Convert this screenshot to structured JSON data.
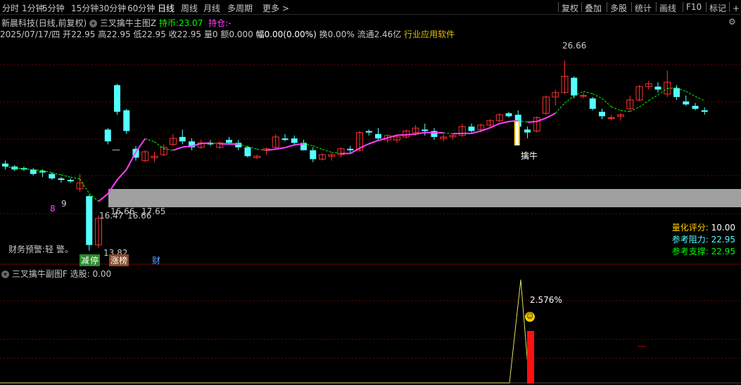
{
  "toolbar": {
    "periods": [
      "分时",
      "1分钟",
      "5分钟",
      "15分钟",
      "30分钟",
      "60分钟",
      "日线",
      "周线",
      "月线",
      "多周期",
      "更多 >"
    ],
    "active_period": "日线",
    "right_buttons": [
      "复权",
      "叠加",
      "多股",
      "统计",
      "画线",
      "F10",
      "标记",
      "+自"
    ]
  },
  "header": {
    "stock_name": "新晨科技",
    "period_info": "(日线,前复权)",
    "indicator": "三叉擒牛主图Z",
    "hold_label": "持币:",
    "hold_value": "23.07",
    "position_label": "持仓:",
    "position_value": "-"
  },
  "quote": {
    "date": "2025/07/17/四",
    "open_label": "开",
    "open": "22.95",
    "high_label": "高",
    "high": "22.95",
    "low_label": "低",
    "low": "22.95",
    "close_label": "收",
    "close": "22.95",
    "volume_label": "量",
    "volume": "0",
    "amount_label": "额",
    "amount": "0.000",
    "change_label": "幅",
    "change": "0.00(0.00%)",
    "turnover_label": "换",
    "turnover": "0.00%",
    "float_label": "流通",
    "float": "2.46亿",
    "industry": "行业应用软件"
  },
  "annotations": {
    "max_price": "26.66",
    "low1": "16.47",
    "low2": "16.66",
    "low3": "16.66",
    "low4": "17.65",
    "min_price": "13.82",
    "count8": "8",
    "count9": "9",
    "dash": "—",
    "signal": "擒牛",
    "warning": "财务预警:轻 警。",
    "tag_reduce": "减",
    "tag_stop": "停",
    "tag_limit": "涨榜",
    "tag_fin": "财"
  },
  "stats": {
    "score_label": "量化评分:",
    "score": "10.00",
    "resist_label": "参考阻力:",
    "resist": "22.95",
    "support_label": "参考支撑:",
    "support": "22.95"
  },
  "sub": {
    "indicator": "三叉擒牛副图F",
    "select_label": "选股:",
    "select_value": "0.00",
    "pct": "2.576%"
  },
  "colors": {
    "up": "#ff3030",
    "down": "#54ffff",
    "line_up": "#ff40ff",
    "line_dn": "#00ff00",
    "grid": "#7a0000",
    "band": "#a0a0a0"
  },
  "chart_data": {
    "type": "candlestick",
    "y_range": [
      13.0,
      28.0
    ],
    "candles": [
      {
        "o": 19.7,
        "h": 19.9,
        "l": 19.3,
        "c": 19.5
      },
      {
        "o": 19.5,
        "h": 19.6,
        "l": 19.2,
        "c": 19.3
      },
      {
        "o": 19.4,
        "h": 19.5,
        "l": 19.2,
        "c": 19.3
      },
      {
        "o": 19.3,
        "h": 19.4,
        "l": 18.9,
        "c": 19.0
      },
      {
        "o": 19.2,
        "h": 19.3,
        "l": 18.8,
        "c": 19.1
      },
      {
        "o": 19.0,
        "h": 19.1,
        "l": 18.6,
        "c": 18.7
      },
      {
        "o": 18.7,
        "h": 18.8,
        "l": 18.4,
        "c": 18.6
      },
      {
        "o": 18.6,
        "h": 18.7,
        "l": 18.4,
        "c": 18.5
      },
      {
        "o": 18.0,
        "h": 19.0,
        "l": 17.8,
        "c": 18.4
      },
      {
        "o": 17.5,
        "h": 17.6,
        "l": 13.82,
        "c": 14.2
      },
      {
        "o": 14.2,
        "h": 16.2,
        "l": 14.0,
        "c": 16.0
      },
      {
        "o": 22.0,
        "h": 22.1,
        "l": 21.0,
        "c": 21.2
      },
      {
        "o": 25.0,
        "h": 25.1,
        "l": 23.0,
        "c": 23.2
      },
      {
        "o": 23.3,
        "h": 23.4,
        "l": 21.7,
        "c": 21.9
      },
      {
        "o": 20.7,
        "h": 20.9,
        "l": 19.9,
        "c": 20.1
      },
      {
        "o": 19.9,
        "h": 20.6,
        "l": 19.8,
        "c": 20.5
      },
      {
        "o": 20.1,
        "h": 20.5,
        "l": 19.8,
        "c": 20.2
      },
      {
        "o": 20.3,
        "h": 21.0,
        "l": 20.2,
        "c": 20.8
      },
      {
        "o": 21.0,
        "h": 21.7,
        "l": 20.9,
        "c": 21.4
      },
      {
        "o": 21.5,
        "h": 22.0,
        "l": 21.0,
        "c": 21.2
      },
      {
        "o": 21.2,
        "h": 21.4,
        "l": 20.6,
        "c": 20.8
      },
      {
        "o": 20.8,
        "h": 21.3,
        "l": 20.7,
        "c": 21.1
      },
      {
        "o": 21.1,
        "h": 21.3,
        "l": 20.9,
        "c": 21.0
      },
      {
        "o": 20.8,
        "h": 21.2,
        "l": 20.7,
        "c": 21.1
      },
      {
        "o": 21.3,
        "h": 21.5,
        "l": 21.0,
        "c": 21.1
      },
      {
        "o": 21.1,
        "h": 21.3,
        "l": 20.6,
        "c": 20.8
      },
      {
        "o": 20.8,
        "h": 20.9,
        "l": 20.1,
        "c": 20.2
      },
      {
        "o": 20.1,
        "h": 20.3,
        "l": 20.0,
        "c": 20.2
      },
      {
        "o": 20.6,
        "h": 20.8,
        "l": 20.3,
        "c": 20.7
      },
      {
        "o": 20.8,
        "h": 21.7,
        "l": 20.7,
        "c": 21.5
      },
      {
        "o": 21.4,
        "h": 21.7,
        "l": 21.2,
        "c": 21.3
      },
      {
        "o": 21.4,
        "h": 21.6,
        "l": 21.0,
        "c": 21.1
      },
      {
        "o": 21.1,
        "h": 21.3,
        "l": 20.6,
        "c": 20.6
      },
      {
        "o": 20.6,
        "h": 20.8,
        "l": 19.8,
        "c": 20.0
      },
      {
        "o": 20.0,
        "h": 20.4,
        "l": 19.9,
        "c": 20.3
      },
      {
        "o": 20.2,
        "h": 20.4,
        "l": 19.9,
        "c": 20.3
      },
      {
        "o": 20.3,
        "h": 20.8,
        "l": 20.1,
        "c": 20.7
      },
      {
        "o": 20.7,
        "h": 20.9,
        "l": 20.4,
        "c": 20.6
      },
      {
        "o": 20.6,
        "h": 21.9,
        "l": 20.5,
        "c": 21.8
      },
      {
        "o": 21.9,
        "h": 22.0,
        "l": 21.6,
        "c": 21.8
      },
      {
        "o": 21.7,
        "h": 22.1,
        "l": 21.3,
        "c": 21.4
      },
      {
        "o": 21.3,
        "h": 21.7,
        "l": 21.1,
        "c": 21.6
      },
      {
        "o": 21.3,
        "h": 21.6,
        "l": 21.1,
        "c": 21.5
      },
      {
        "o": 21.5,
        "h": 22.0,
        "l": 21.4,
        "c": 21.9
      },
      {
        "o": 21.8,
        "h": 22.3,
        "l": 21.6,
        "c": 22.1
      },
      {
        "o": 22.0,
        "h": 22.4,
        "l": 21.6,
        "c": 21.9
      },
      {
        "o": 21.9,
        "h": 22.1,
        "l": 21.3,
        "c": 21.5
      },
      {
        "o": 21.4,
        "h": 21.7,
        "l": 21.2,
        "c": 21.5
      },
      {
        "o": 21.5,
        "h": 21.7,
        "l": 21.3,
        "c": 21.6
      },
      {
        "o": 21.6,
        "h": 22.4,
        "l": 21.5,
        "c": 22.2
      },
      {
        "o": 22.2,
        "h": 22.4,
        "l": 21.8,
        "c": 21.9
      },
      {
        "o": 22.0,
        "h": 22.4,
        "l": 21.8,
        "c": 22.3
      },
      {
        "o": 22.3,
        "h": 22.7,
        "l": 22.1,
        "c": 22.6
      },
      {
        "o": 22.6,
        "h": 23.1,
        "l": 22.5,
        "c": 23.0
      },
      {
        "o": 23.1,
        "h": 23.2,
        "l": 22.8,
        "c": 22.9
      },
      {
        "o": 23.0,
        "h": 23.3,
        "l": 21.9,
        "c": 22.2
      },
      {
        "o": 22.0,
        "h": 22.2,
        "l": 21.4,
        "c": 21.8
      },
      {
        "o": 21.9,
        "h": 22.9,
        "l": 21.8,
        "c": 22.8
      },
      {
        "o": 23.1,
        "h": 24.3,
        "l": 23.0,
        "c": 24.2
      },
      {
        "o": 24.2,
        "h": 24.7,
        "l": 23.6,
        "c": 24.5
      },
      {
        "o": 24.5,
        "h": 26.66,
        "l": 24.4,
        "c": 25.6
      },
      {
        "o": 25.5,
        "h": 25.6,
        "l": 24.1,
        "c": 24.3
      },
      {
        "o": 24.3,
        "h": 24.5,
        "l": 24.1,
        "c": 24.3
      },
      {
        "o": 24.1,
        "h": 24.2,
        "l": 23.3,
        "c": 23.4
      },
      {
        "o": 23.2,
        "h": 23.4,
        "l": 22.7,
        "c": 22.9
      },
      {
        "o": 22.8,
        "h": 23.0,
        "l": 22.6,
        "c": 22.8
      },
      {
        "o": 22.9,
        "h": 23.1,
        "l": 22.6,
        "c": 23.0
      },
      {
        "o": 23.4,
        "h": 24.3,
        "l": 23.3,
        "c": 24.0
      },
      {
        "o": 24.0,
        "h": 25.0,
        "l": 23.9,
        "c": 24.9
      },
      {
        "o": 24.9,
        "h": 25.3,
        "l": 24.7,
        "c": 25.1
      },
      {
        "o": 24.9,
        "h": 25.2,
        "l": 24.5,
        "c": 24.7
      },
      {
        "o": 24.4,
        "h": 26.0,
        "l": 24.2,
        "c": 25.2
      },
      {
        "o": 24.8,
        "h": 25.0,
        "l": 24.0,
        "c": 24.2
      },
      {
        "o": 23.9,
        "h": 24.3,
        "l": 23.6,
        "c": 23.7
      },
      {
        "o": 23.6,
        "h": 23.8,
        "l": 23.3,
        "c": 23.4
      },
      {
        "o": 23.3,
        "h": 23.5,
        "l": 23.0,
        "c": 23.2
      }
    ]
  }
}
